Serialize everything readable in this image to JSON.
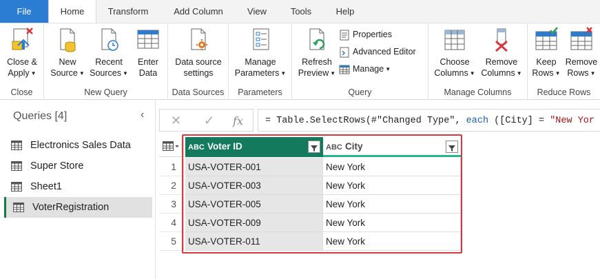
{
  "tabs": [
    "File",
    "Home",
    "Transform",
    "Add Column",
    "View",
    "Tools",
    "Help"
  ],
  "active_tab": "Home",
  "ribbon": {
    "close": {
      "group": "Close",
      "close_apply": [
        "Close &",
        "Apply"
      ]
    },
    "new_query": {
      "group": "New Query",
      "new_source": [
        "New",
        "Source"
      ],
      "recent_sources": [
        "Recent",
        "Sources"
      ],
      "enter_data": [
        "Enter",
        "Data"
      ]
    },
    "data_sources": {
      "group": "Data Sources",
      "settings": [
        "Data source",
        "settings"
      ]
    },
    "parameters": {
      "group": "Parameters",
      "manage": [
        "Manage",
        "Parameters"
      ]
    },
    "query": {
      "group": "Query",
      "refresh": [
        "Refresh",
        "Preview"
      ],
      "properties": "Properties",
      "advanced_editor": "Advanced Editor",
      "manage": "Manage"
    },
    "manage_columns": {
      "group": "Manage Columns",
      "choose": [
        "Choose",
        "Columns"
      ],
      "remove": [
        "Remove",
        "Columns"
      ]
    },
    "reduce_rows": {
      "group": "Reduce Rows",
      "keep": [
        "Keep",
        "Rows"
      ],
      "remove": [
        "Remove",
        "Rows"
      ]
    }
  },
  "queries": {
    "title": "Queries [4]",
    "collapse_glyph": "‹",
    "items": [
      "Electronics Sales Data",
      "Super Store",
      "Sheet1",
      "VoterRegistration"
    ],
    "selected": "VoterRegistration"
  },
  "formula": {
    "cancel": "✕",
    "commit": "✓",
    "fx": "fx",
    "p1": "= Table.SelectRows(#\"Changed Type\", ",
    "kw": "each",
    "p2": " ([City] = ",
    "str": "\"New Yor"
  },
  "grid": {
    "type_label": "ABC",
    "columns": [
      "Voter ID",
      "City"
    ],
    "rows": [
      [
        "1",
        "USA-VOTER-001",
        "New York"
      ],
      [
        "2",
        "USA-VOTER-003",
        "New York"
      ],
      [
        "3",
        "USA-VOTER-005",
        "New York"
      ],
      [
        "4",
        "USA-VOTER-009",
        "New York"
      ],
      [
        "5",
        "USA-VOTER-011",
        "New York"
      ]
    ]
  },
  "colors": {
    "accent": "#2b7cd3",
    "column_selected": "#137a5e",
    "highlight": "#d9363e",
    "selected_marker": "#107c41"
  }
}
